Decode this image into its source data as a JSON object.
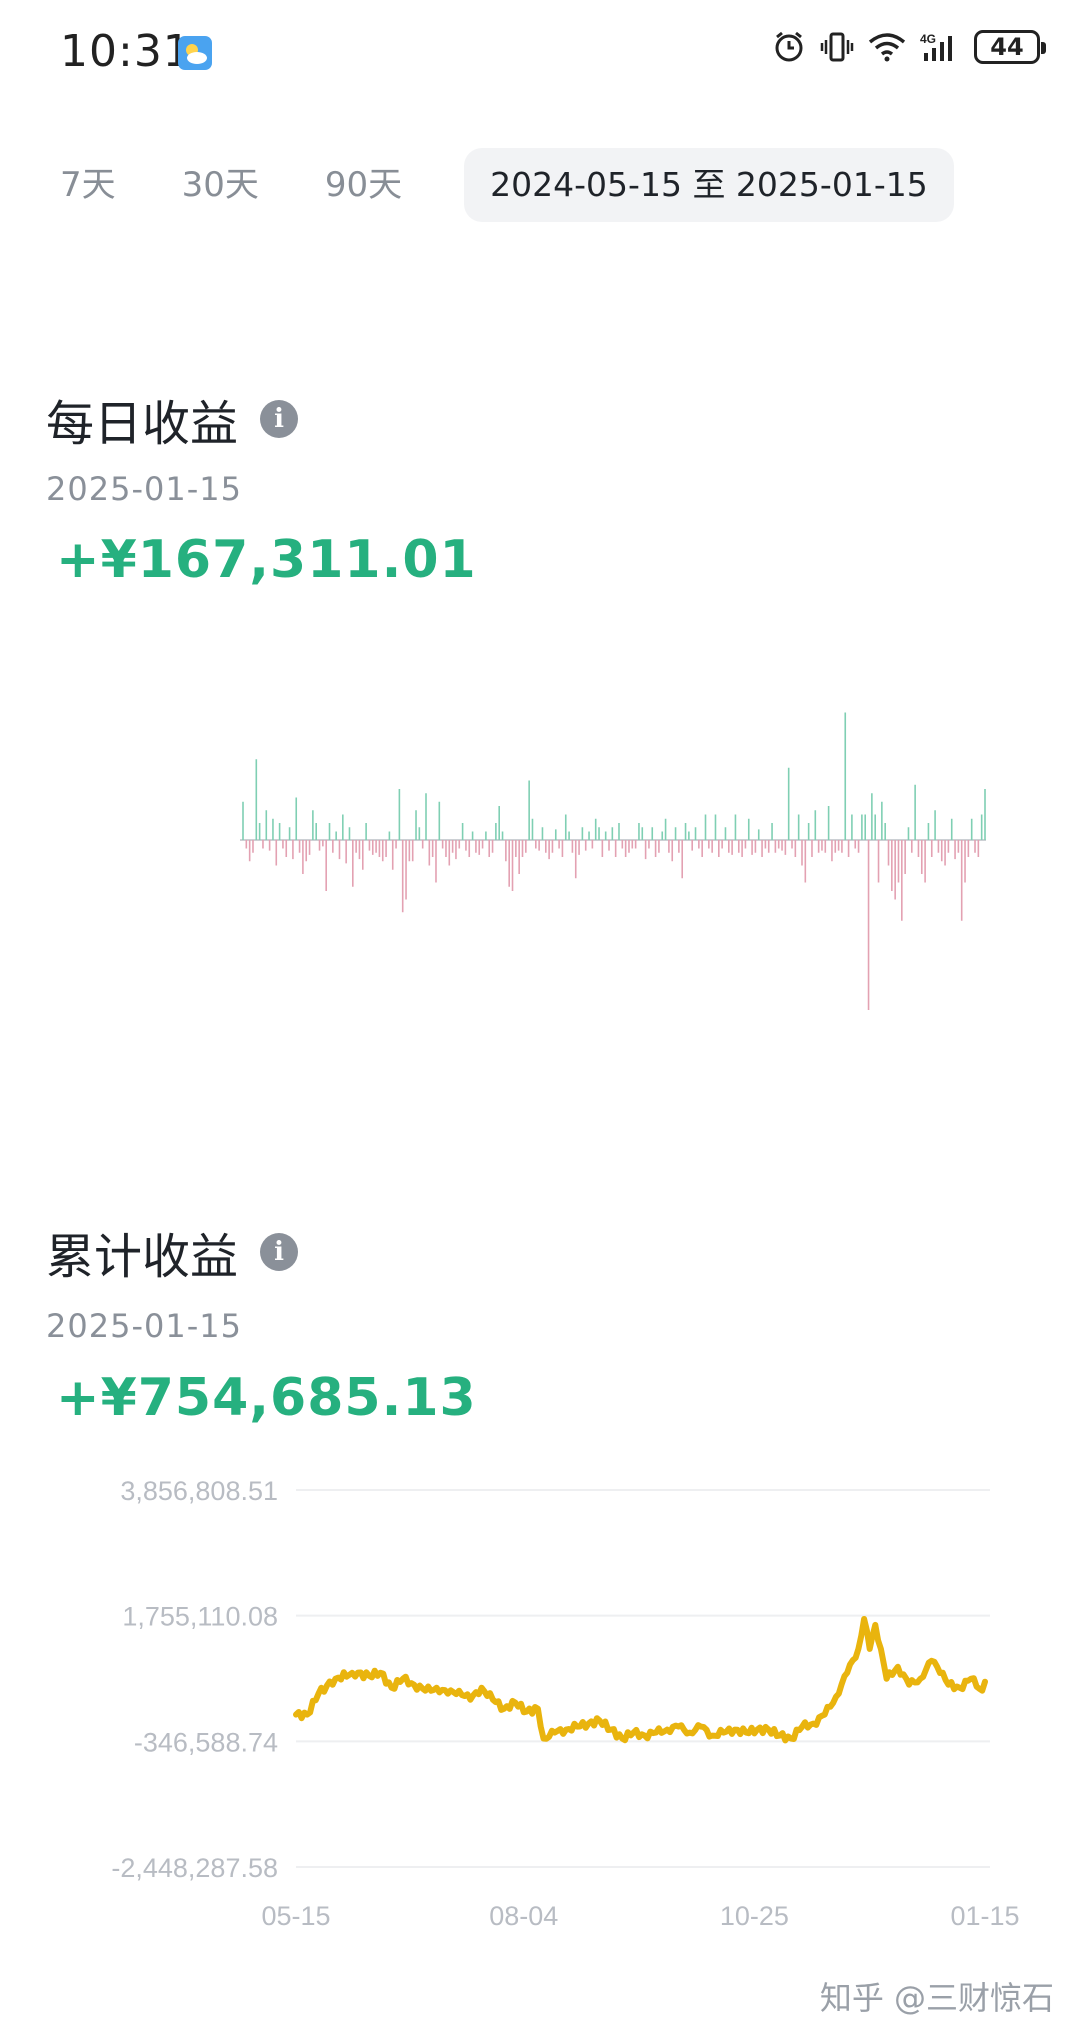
{
  "status_bar": {
    "time": "10:31",
    "icons": [
      "weather-icon",
      "alarm-icon",
      "vibrate-icon",
      "wifi-icon",
      "signal-4g-icon",
      "battery-icon"
    ],
    "battery_level": "44"
  },
  "range_tabs": [
    {
      "label": "7天",
      "active": false
    },
    {
      "label": "30天",
      "active": false
    },
    {
      "label": "90天",
      "active": false
    },
    {
      "label": "2024-05-15 至 2025-01-15",
      "active": true
    }
  ],
  "daily": {
    "title": "每日收益",
    "date": "2025-01-15",
    "value": "+¥167,311.01"
  },
  "cumulative": {
    "title": "累计收益",
    "date": "2025-01-15",
    "value": "+¥754,685.13"
  },
  "colors": {
    "positive": "#26b07f",
    "daily_positive_bar": "#7fcfb3",
    "daily_negative_bar": "#e3a1b2",
    "cumulative_line": "#e9b40e",
    "grid": "#eeeff1"
  },
  "watermark": "知乎 @三财惊石",
  "chart_data": [
    {
      "type": "bar",
      "name": "daily",
      "xlabel": "",
      "ylabel": "",
      "grid": false,
      "note_scale": "approximate, no y axis printed",
      "values": [
        90000,
        -20000,
        -50000,
        -30000,
        190000,
        40000,
        -20000,
        70000,
        -25000,
        50000,
        -60000,
        40000,
        -20000,
        -40000,
        30000,
        -45000,
        100000,
        -30000,
        -80000,
        -50000,
        -35000,
        70000,
        40000,
        -25000,
        -15000,
        -120000,
        40000,
        -30000,
        20000,
        -45000,
        60000,
        -55000,
        30000,
        -110000,
        -30000,
        -45000,
        -70000,
        40000,
        -25000,
        -35000,
        -30000,
        -40000,
        -50000,
        -40000,
        20000,
        -70000,
        -20000,
        120000,
        -170000,
        -140000,
        -50000,
        -50000,
        70000,
        30000,
        -20000,
        110000,
        -60000,
        -40000,
        -100000,
        90000,
        -20000,
        -40000,
        -60000,
        -30000,
        -45000,
        -20000,
        40000,
        -25000,
        -40000,
        20000,
        -30000,
        -35000,
        -20000,
        20000,
        -40000,
        -30000,
        40000,
        80000,
        20000,
        -50000,
        -110000,
        -120000,
        -40000,
        -80000,
        -40000,
        -30000,
        140000,
        50000,
        -20000,
        -25000,
        30000,
        -30000,
        -45000,
        -30000,
        25000,
        -20000,
        -40000,
        60000,
        20000,
        -30000,
        -90000,
        -35000,
        30000,
        -25000,
        20000,
        -20000,
        50000,
        30000,
        -40000,
        20000,
        -25000,
        30000,
        -40000,
        40000,
        -20000,
        -40000,
        -30000,
        -20000,
        -20000,
        40000,
        30000,
        -45000,
        -20000,
        30000,
        -40000,
        -30000,
        20000,
        50000,
        -30000,
        -50000,
        30000,
        -30000,
        -90000,
        40000,
        20000,
        -25000,
        30000,
        -20000,
        -40000,
        60000,
        -20000,
        -30000,
        60000,
        -40000,
        -20000,
        30000,
        -30000,
        -35000,
        60000,
        -30000,
        -40000,
        -20000,
        50000,
        -35000,
        -30000,
        25000,
        -40000,
        -20000,
        -30000,
        40000,
        -30000,
        -20000,
        -25000,
        -35000,
        170000,
        -20000,
        -40000,
        60000,
        -60000,
        -100000,
        40000,
        -40000,
        70000,
        -30000,
        -25000,
        -30000,
        80000,
        -50000,
        -30000,
        -25000,
        -30000,
        300000,
        -40000,
        60000,
        -20000,
        -30000,
        60000,
        60000,
        -400000,
        110000,
        60000,
        -100000,
        90000,
        40000,
        -60000,
        -120000,
        -140000,
        -100000,
        -190000,
        -80000,
        30000,
        -30000,
        130000,
        -40000,
        -80000,
        -100000,
        40000,
        -40000,
        70000,
        -30000,
        -50000,
        -60000,
        -30000,
        50000,
        -45000,
        -30000,
        -190000,
        -100000,
        -40000,
        50000,
        -30000,
        -40000,
        60000,
        120000
      ]
    },
    {
      "type": "line",
      "name": "cumulative",
      "xlabel": "",
      "ylabel": "",
      "grid": true,
      "ylim": [
        -2448287.58,
        3856808.51
      ],
      "y_ticks": [
        "3,856,808.51",
        "1,755,110.08",
        "-346,588.74",
        "-2,448,287.58"
      ],
      "y_tick_values": [
        3856808.51,
        1755110.08,
        -346588.74,
        -2448287.58
      ],
      "x_tick_labels": [
        "05-15",
        "08-04",
        "10-25",
        "01-15"
      ],
      "x_ticks_at_index": [
        0,
        81,
        163,
        245
      ],
      "x_start_date": "2024-05-15",
      "points": [
        [
          0,
          100000
        ],
        [
          4,
          100000
        ],
        [
          8,
          450000
        ],
        [
          14,
          700000
        ],
        [
          20,
          800000
        ],
        [
          26,
          750000
        ],
        [
          30,
          800000
        ],
        [
          34,
          550000
        ],
        [
          38,
          700000
        ],
        [
          42,
          600000
        ],
        [
          46,
          500000
        ],
        [
          50,
          550000
        ],
        [
          54,
          450000
        ],
        [
          58,
          500000
        ],
        [
          62,
          350000
        ],
        [
          66,
          550000
        ],
        [
          70,
          350000
        ],
        [
          74,
          200000
        ],
        [
          78,
          300000
        ],
        [
          82,
          150000
        ],
        [
          86,
          200000
        ],
        [
          88,
          -300000
        ],
        [
          92,
          -200000
        ],
        [
          96,
          -150000
        ],
        [
          100,
          -100000
        ],
        [
          104,
          -50000
        ],
        [
          108,
          0
        ],
        [
          112,
          -150000
        ],
        [
          116,
          -300000
        ],
        [
          120,
          -200000
        ],
        [
          124,
          -250000
        ],
        [
          128,
          -200000
        ],
        [
          132,
          -150000
        ],
        [
          136,
          -100000
        ],
        [
          140,
          -200000
        ],
        [
          144,
          -100000
        ],
        [
          148,
          -250000
        ],
        [
          152,
          -200000
        ],
        [
          156,
          -150000
        ],
        [
          160,
          -200000
        ],
        [
          164,
          -150000
        ],
        [
          168,
          -150000
        ],
        [
          172,
          -250000
        ],
        [
          176,
          -300000
        ],
        [
          180,
          -100000
        ],
        [
          184,
          -50000
        ],
        [
          188,
          100000
        ],
        [
          192,
          400000
        ],
        [
          196,
          800000
        ],
        [
          200,
          1200000
        ],
        [
          202,
          1700000
        ],
        [
          204,
          1200000
        ],
        [
          206,
          1600000
        ],
        [
          208,
          1200000
        ],
        [
          210,
          700000
        ],
        [
          214,
          900000
        ],
        [
          218,
          600000
        ],
        [
          222,
          700000
        ],
        [
          226,
          1000000
        ],
        [
          228,
          900000
        ],
        [
          230,
          800000
        ],
        [
          232,
          600000
        ],
        [
          236,
          550000
        ],
        [
          240,
          700000
        ],
        [
          244,
          500000
        ],
        [
          245,
          650000
        ]
      ]
    }
  ]
}
